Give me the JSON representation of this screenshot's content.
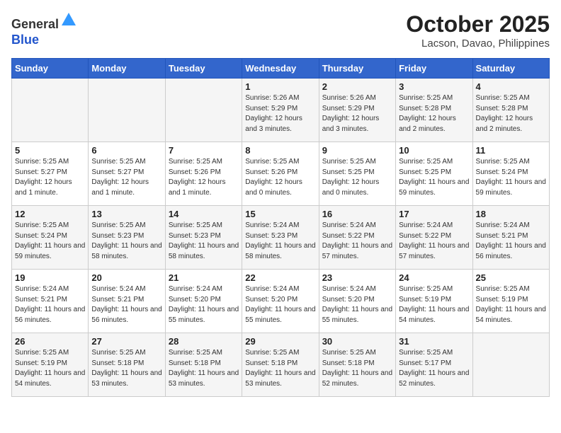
{
  "header": {
    "logo_general": "General",
    "logo_blue": "Blue",
    "month": "October 2025",
    "location": "Lacson, Davao, Philippines"
  },
  "days_of_week": [
    "Sunday",
    "Monday",
    "Tuesday",
    "Wednesday",
    "Thursday",
    "Friday",
    "Saturday"
  ],
  "weeks": [
    [
      {
        "day": "",
        "info": ""
      },
      {
        "day": "",
        "info": ""
      },
      {
        "day": "",
        "info": ""
      },
      {
        "day": "1",
        "info": "Sunrise: 5:26 AM\nSunset: 5:29 PM\nDaylight: 12 hours\nand 3 minutes."
      },
      {
        "day": "2",
        "info": "Sunrise: 5:26 AM\nSunset: 5:29 PM\nDaylight: 12 hours\nand 3 minutes."
      },
      {
        "day": "3",
        "info": "Sunrise: 5:25 AM\nSunset: 5:28 PM\nDaylight: 12 hours\nand 2 minutes."
      },
      {
        "day": "4",
        "info": "Sunrise: 5:25 AM\nSunset: 5:28 PM\nDaylight: 12 hours\nand 2 minutes."
      }
    ],
    [
      {
        "day": "5",
        "info": "Sunrise: 5:25 AM\nSunset: 5:27 PM\nDaylight: 12 hours\nand 1 minute."
      },
      {
        "day": "6",
        "info": "Sunrise: 5:25 AM\nSunset: 5:27 PM\nDaylight: 12 hours\nand 1 minute."
      },
      {
        "day": "7",
        "info": "Sunrise: 5:25 AM\nSunset: 5:26 PM\nDaylight: 12 hours\nand 1 minute."
      },
      {
        "day": "8",
        "info": "Sunrise: 5:25 AM\nSunset: 5:26 PM\nDaylight: 12 hours\nand 0 minutes."
      },
      {
        "day": "9",
        "info": "Sunrise: 5:25 AM\nSunset: 5:25 PM\nDaylight: 12 hours\nand 0 minutes."
      },
      {
        "day": "10",
        "info": "Sunrise: 5:25 AM\nSunset: 5:25 PM\nDaylight: 11 hours\nand 59 minutes."
      },
      {
        "day": "11",
        "info": "Sunrise: 5:25 AM\nSunset: 5:24 PM\nDaylight: 11 hours\nand 59 minutes."
      }
    ],
    [
      {
        "day": "12",
        "info": "Sunrise: 5:25 AM\nSunset: 5:24 PM\nDaylight: 11 hours\nand 59 minutes."
      },
      {
        "day": "13",
        "info": "Sunrise: 5:25 AM\nSunset: 5:23 PM\nDaylight: 11 hours\nand 58 minutes."
      },
      {
        "day": "14",
        "info": "Sunrise: 5:25 AM\nSunset: 5:23 PM\nDaylight: 11 hours\nand 58 minutes."
      },
      {
        "day": "15",
        "info": "Sunrise: 5:24 AM\nSunset: 5:23 PM\nDaylight: 11 hours\nand 58 minutes."
      },
      {
        "day": "16",
        "info": "Sunrise: 5:24 AM\nSunset: 5:22 PM\nDaylight: 11 hours\nand 57 minutes."
      },
      {
        "day": "17",
        "info": "Sunrise: 5:24 AM\nSunset: 5:22 PM\nDaylight: 11 hours\nand 57 minutes."
      },
      {
        "day": "18",
        "info": "Sunrise: 5:24 AM\nSunset: 5:21 PM\nDaylight: 11 hours\nand 56 minutes."
      }
    ],
    [
      {
        "day": "19",
        "info": "Sunrise: 5:24 AM\nSunset: 5:21 PM\nDaylight: 11 hours\nand 56 minutes."
      },
      {
        "day": "20",
        "info": "Sunrise: 5:24 AM\nSunset: 5:21 PM\nDaylight: 11 hours\nand 56 minutes."
      },
      {
        "day": "21",
        "info": "Sunrise: 5:24 AM\nSunset: 5:20 PM\nDaylight: 11 hours\nand 55 minutes."
      },
      {
        "day": "22",
        "info": "Sunrise: 5:24 AM\nSunset: 5:20 PM\nDaylight: 11 hours\nand 55 minutes."
      },
      {
        "day": "23",
        "info": "Sunrise: 5:24 AM\nSunset: 5:20 PM\nDaylight: 11 hours\nand 55 minutes."
      },
      {
        "day": "24",
        "info": "Sunrise: 5:25 AM\nSunset: 5:19 PM\nDaylight: 11 hours\nand 54 minutes."
      },
      {
        "day": "25",
        "info": "Sunrise: 5:25 AM\nSunset: 5:19 PM\nDaylight: 11 hours\nand 54 minutes."
      }
    ],
    [
      {
        "day": "26",
        "info": "Sunrise: 5:25 AM\nSunset: 5:19 PM\nDaylight: 11 hours\nand 54 minutes."
      },
      {
        "day": "27",
        "info": "Sunrise: 5:25 AM\nSunset: 5:18 PM\nDaylight: 11 hours\nand 53 minutes."
      },
      {
        "day": "28",
        "info": "Sunrise: 5:25 AM\nSunset: 5:18 PM\nDaylight: 11 hours\nand 53 minutes."
      },
      {
        "day": "29",
        "info": "Sunrise: 5:25 AM\nSunset: 5:18 PM\nDaylight: 11 hours\nand 53 minutes."
      },
      {
        "day": "30",
        "info": "Sunrise: 5:25 AM\nSunset: 5:18 PM\nDaylight: 11 hours\nand 52 minutes."
      },
      {
        "day": "31",
        "info": "Sunrise: 5:25 AM\nSunset: 5:17 PM\nDaylight: 11 hours\nand 52 minutes."
      },
      {
        "day": "",
        "info": ""
      }
    ]
  ]
}
